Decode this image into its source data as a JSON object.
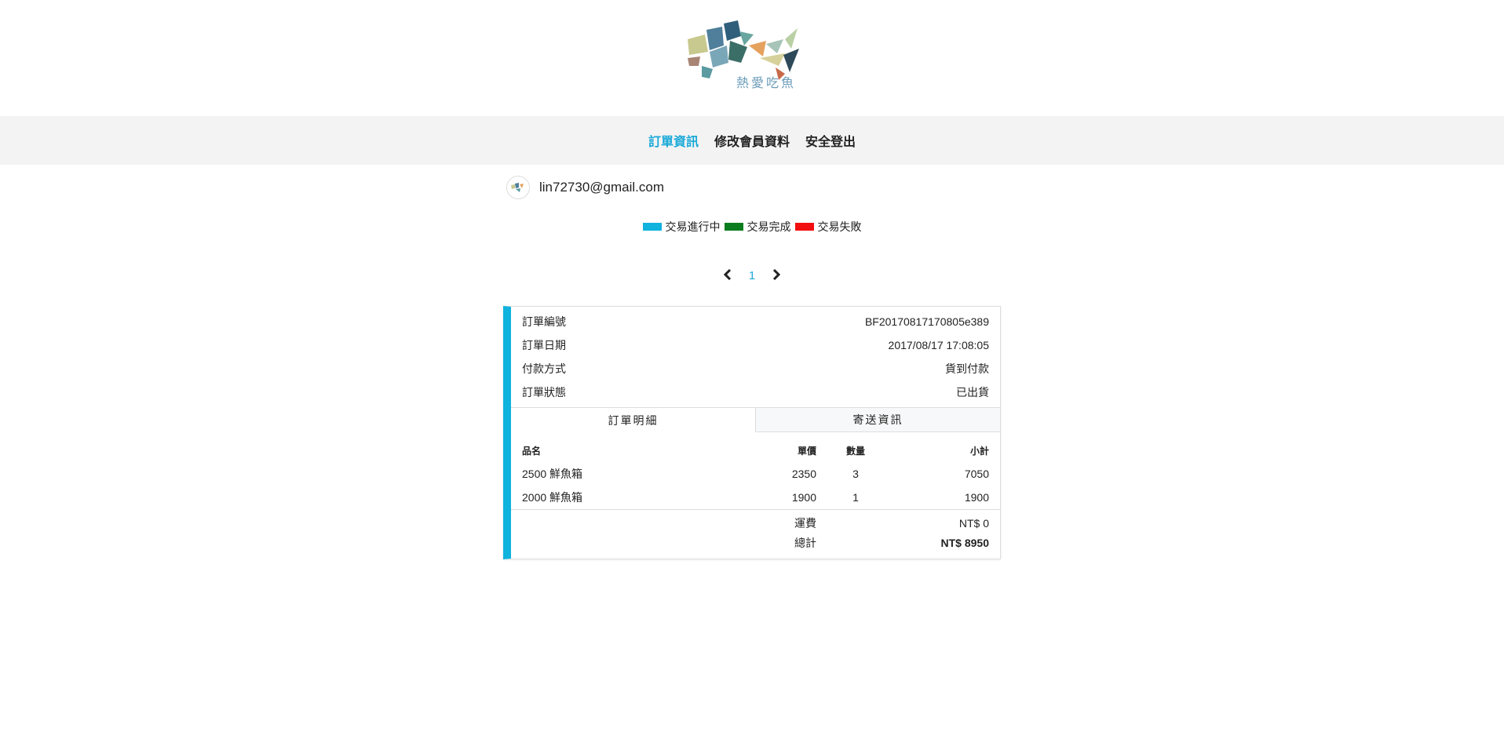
{
  "header": {
    "logo_text": "熱愛吃魚"
  },
  "nav": {
    "items": [
      {
        "label": "訂單資訊",
        "active": true
      },
      {
        "label": "修改會員資料",
        "active": false
      },
      {
        "label": "安全登出",
        "active": false
      }
    ]
  },
  "user": {
    "email": "lin72730@gmail.com"
  },
  "legend": [
    {
      "label": "交易進行中",
      "color": "#10b2de"
    },
    {
      "label": "交易完成",
      "color": "#0b7d1f"
    },
    {
      "label": "交易失敗",
      "color": "#f20f0f"
    }
  ],
  "pager": {
    "prev_icon": "chevron-left-icon",
    "next_icon": "chevron-right-icon",
    "current": "1"
  },
  "order": {
    "status_color": "#10b2de",
    "meta": [
      {
        "label": "訂單編號",
        "value": "BF20170817170805e389"
      },
      {
        "label": "訂單日期",
        "value": "2017/08/17 17:08:05"
      },
      {
        "label": "付款方式",
        "value": "貨到付款"
      },
      {
        "label": "訂單狀態",
        "value": "已出貨"
      }
    ],
    "tabs": [
      {
        "label": "訂單明細",
        "active": true
      },
      {
        "label": "寄送資訊",
        "active": false
      }
    ],
    "columns": {
      "name": "品名",
      "price": "單價",
      "qty": "數量",
      "subtotal": "小計"
    },
    "items": [
      {
        "name": "2500 鮮魚箱",
        "price": "2350",
        "qty": "3",
        "subtotal": "7050"
      },
      {
        "name": "2000 鮮魚箱",
        "price": "1900",
        "qty": "1",
        "subtotal": "1900"
      }
    ],
    "shipping": {
      "label": "運費",
      "value": "NT$ 0"
    },
    "total": {
      "label": "總計",
      "value": "NT$ 8950"
    }
  }
}
